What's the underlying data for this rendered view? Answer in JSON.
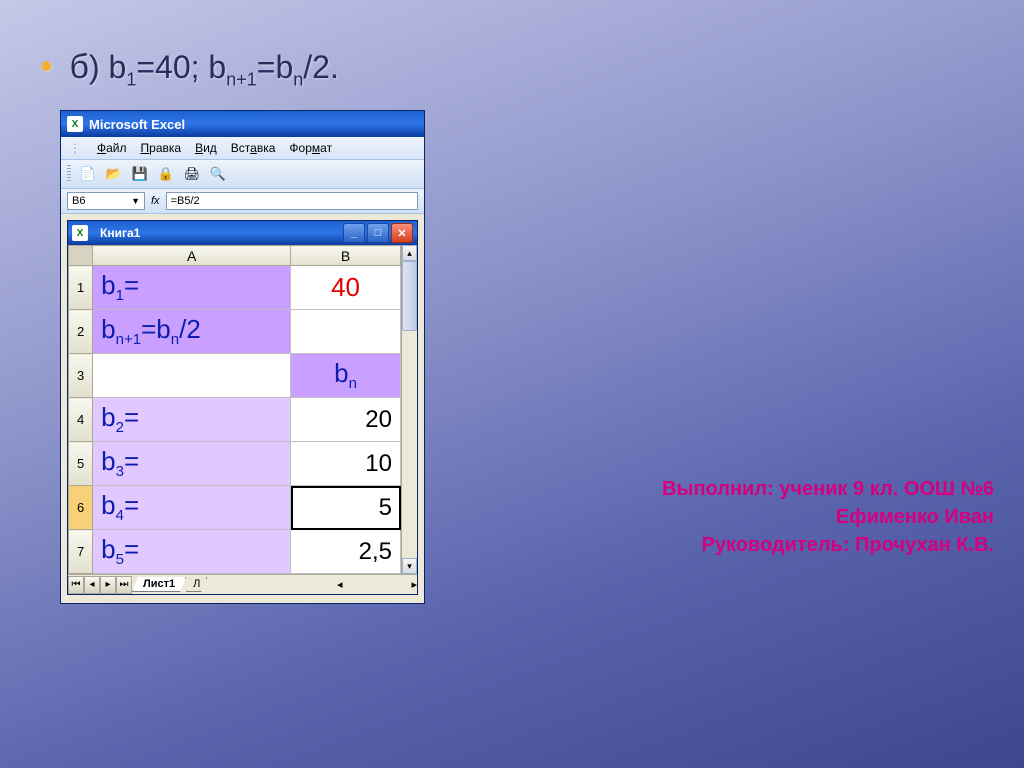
{
  "heading": {
    "bullet": "•",
    "letter": "б",
    "paren": ")",
    "text_html": "b<sub>1</sub>=40; b<sub>n+1</sub>=b<sub>n</sub>/2."
  },
  "app": {
    "title": "Microsoft Excel"
  },
  "menu": {
    "file": "Файл",
    "edit": "Правка",
    "view": "Вид",
    "insert": "Вставка",
    "format": "Формат"
  },
  "toolbar_icons": {
    "new": "📄",
    "open": "📂",
    "save": "💾",
    "perm": "🔒",
    "print": "🖨",
    "preview": "🔍"
  },
  "formula_bar": {
    "name_box": "B6",
    "fx": "fx",
    "formula": "=B5/2"
  },
  "workbook": {
    "title": "Книга1",
    "columns": {
      "A": "A",
      "B": "B"
    },
    "rows": [
      {
        "n": "1",
        "A_html": "b<sub>1</sub>=",
        "B": "40",
        "A_class": "lilac labelcell",
        "B_class": "redval"
      },
      {
        "n": "2",
        "A_html": "b<sub>n+1</sub>=b<sub>n</sub>/2",
        "B": "",
        "A_class": "lilac labelcell",
        "B_class": ""
      },
      {
        "n": "3",
        "A_html": "",
        "B_html": "b<sub>n</sub>",
        "A_class": "",
        "B_class": "lilac hdrcell"
      },
      {
        "n": "4",
        "A_html": "b<sub>2</sub>=",
        "B": "20",
        "A_class": "lilac-light labelcell",
        "B_class": "valcell"
      },
      {
        "n": "5",
        "A_html": "b<sub>3</sub>=",
        "B": "10",
        "A_class": "lilac-light labelcell",
        "B_class": "valcell"
      },
      {
        "n": "6",
        "A_html": "b<sub>4</sub>=",
        "B": "5",
        "A_class": "lilac-light labelcell",
        "B_class": "valcell selected",
        "active": true
      },
      {
        "n": "7",
        "A_html": "b<sub>5</sub>=",
        "B": "2,5",
        "A_class": "lilac-light labelcell",
        "B_class": "valcell"
      }
    ],
    "sheet_tab": "Лист1",
    "sheet_tab2": "Л"
  },
  "credits": {
    "line1": "Выполнил: ученик 9 кл. ООШ №6",
    "line2": "Ефименко Иван",
    "line3": "Руководитель: Прочухан К.В."
  }
}
